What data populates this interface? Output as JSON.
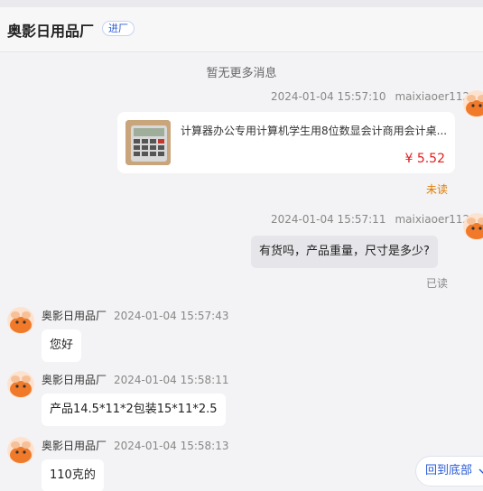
{
  "header": {
    "shop_name": "奥影日用品厂",
    "tag": "进厂"
  },
  "notice": "暂无更多消息",
  "messages": {
    "m1": {
      "time": "2024-01-04 15:57:10",
      "sender": "maixiaoer112",
      "product_title": "计算器办公专用计算机学生用8位数显会计商用会计桌...",
      "price": "¥ 5.52",
      "status": "未读"
    },
    "m2": {
      "time": "2024-01-04 15:57:11",
      "sender": "maixiaoer112",
      "text": "有货吗，产品重量，尺寸是多少?",
      "status": "已读"
    },
    "m3": {
      "sender": "奥影日用品厂",
      "time": "2024-01-04 15:57:43",
      "text": "您好"
    },
    "m4": {
      "sender": "奥影日用品厂",
      "time": "2024-01-04 15:58:11",
      "text": "产品14.5*11*2包装15*11*2.5"
    },
    "m5": {
      "sender": "奥影日用品厂",
      "time": "2024-01-04 15:58:13",
      "text": "110克的"
    }
  },
  "scroll_button": "回到底部",
  "colors": {
    "accent": "#2a5bd7",
    "price": "#e02020",
    "unread": "#e07b00",
    "avatar_orange": "#f07a2a"
  }
}
